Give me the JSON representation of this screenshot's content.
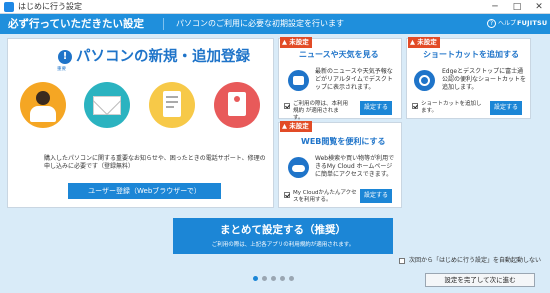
{
  "window": {
    "title": "はじめに行う設定",
    "minimize_glyph": "─",
    "maximize_glyph": "□",
    "close_glyph": "✕"
  },
  "header": {
    "title": "必ず行っていただきたい設定",
    "subtitle": "パソコンのご利用に必要な初期設定を行います",
    "help_label": "ヘルプ",
    "help_glyph": "?",
    "brand": "FUJITSU",
    "background": "#1f8fdc"
  },
  "main_card": {
    "icon": "exclamation-circle-icon",
    "icon_glyph": "!",
    "icon_label": "重要",
    "title": "パソコンの新規・追加登録",
    "body": "購入したパソコンに関する重要なお知らせや、困ったときの電話サポート、修理の申し込みに必要です（登録無料）",
    "register_button": "ユーザー登録（Webブラウザーで）",
    "decorations": [
      {
        "name": "person-illustration",
        "color": "#f5a623"
      },
      {
        "name": "mail-illustration",
        "color": "#2bb3c0"
      },
      {
        "name": "document-illustration",
        "color": "#f7c948"
      },
      {
        "name": "alert-illustration",
        "color": "#e85a5a"
      }
    ]
  },
  "news_card": {
    "badge": "未設定",
    "title": "ニュースや天気を見る",
    "description": "最新のニュースや天気予報などがリアルタイムでデスクトップに表示されます。",
    "check_label": "ご利用の際は、本利用規約 が適用されます。",
    "button": "設定する"
  },
  "shortcut_card": {
    "badge": "未設定",
    "title": "ショートカットを追加する",
    "description": "Edgeとデスクトップに富士通公認の便利なショートカットを追加します。",
    "check_label": "ショートカットを追加します。",
    "button": "設定する"
  },
  "web_card": {
    "badge": "未設定",
    "title": "WEB閲覧を便利にする",
    "description": "Web検索や買い物等が利用できるMy Cloud ホームページに簡単にアクセスできます。",
    "check_label": "My Cloudかんたんアクセスを利用する。",
    "button": "設定する"
  },
  "primary_action": {
    "label": "まとめて設定する（推奨）",
    "sublabel": "ご利用の際は、上記各アプリの利用規約が適用されます。"
  },
  "startup_option": {
    "label": "次回から「はじめに行う設定」を自動起動しない",
    "checked": false
  },
  "pagination": {
    "total": 5,
    "current": 1,
    "active_color": "#1c86d6",
    "inactive_color": "#9aa6b2"
  },
  "finish_button": "設定を完了して次に進む"
}
